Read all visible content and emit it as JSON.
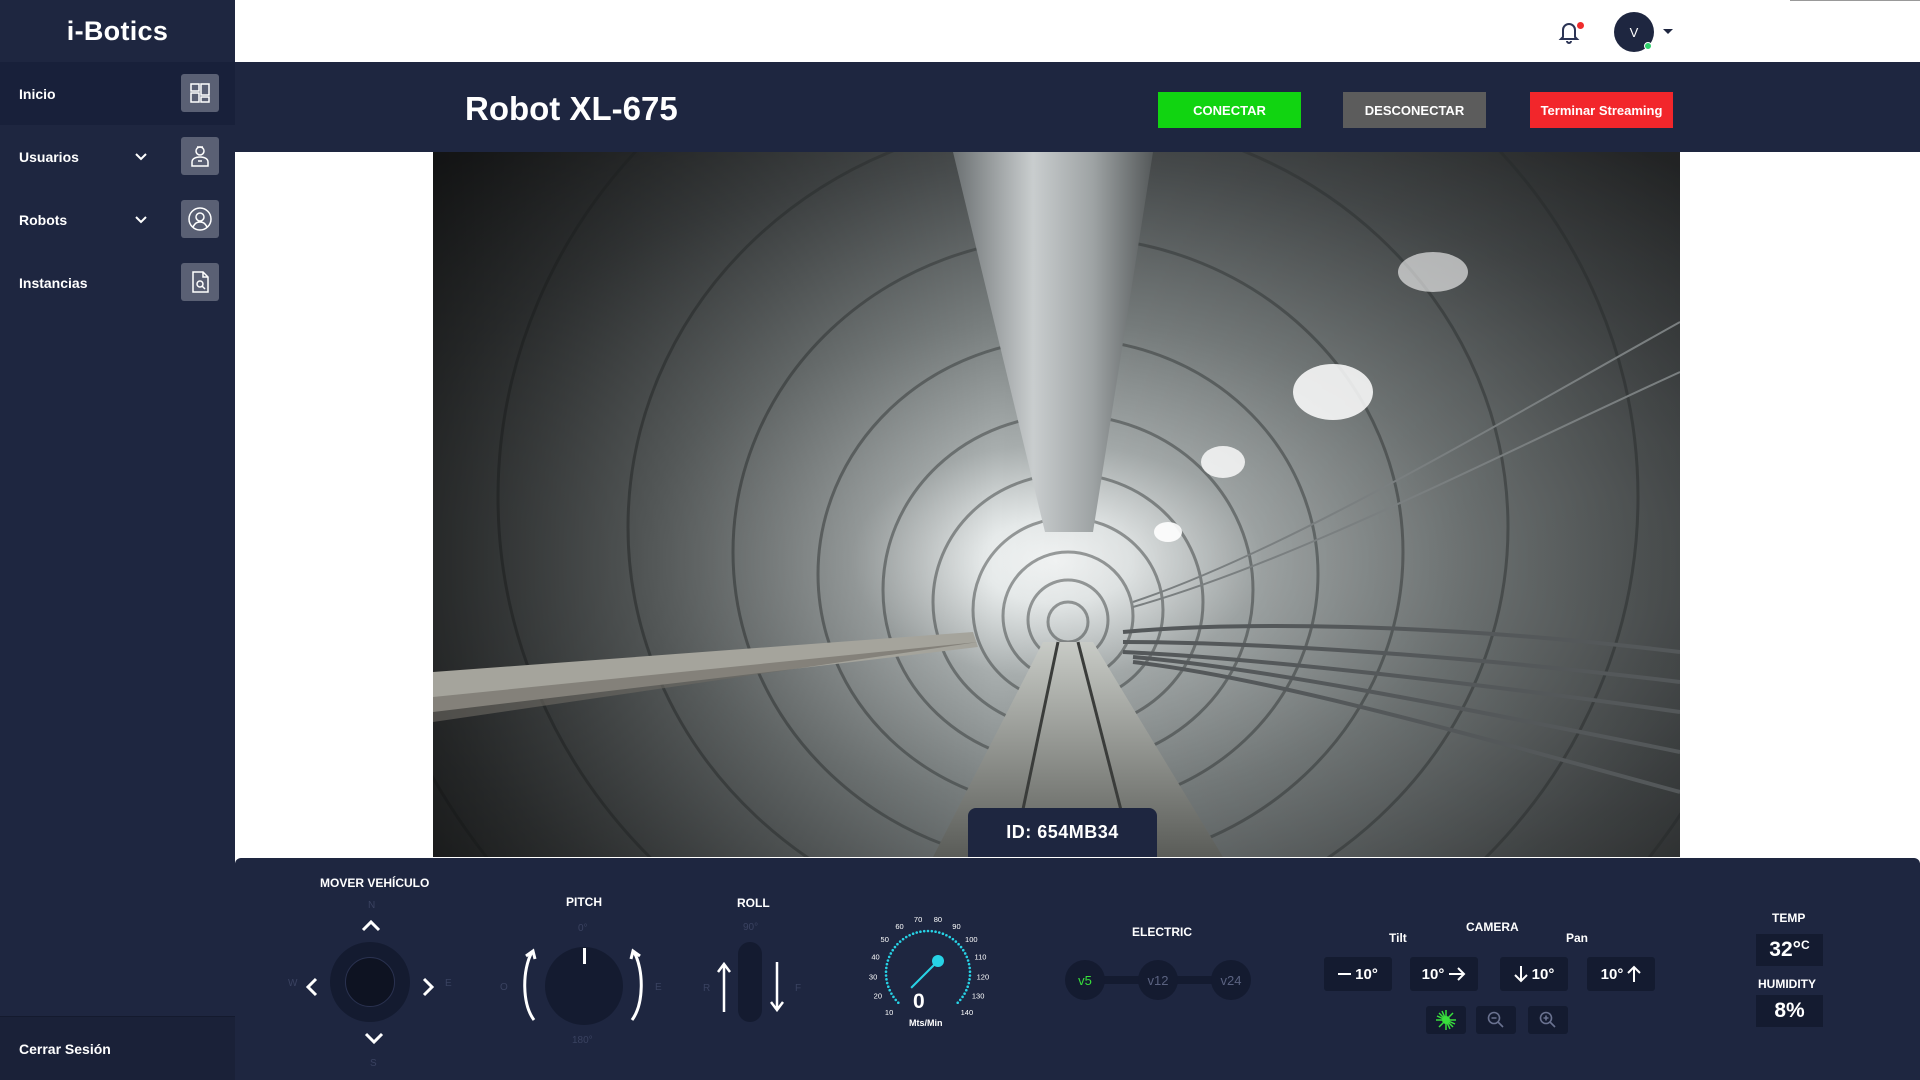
{
  "app": {
    "brand": "i-Botics"
  },
  "sidebar": {
    "items": [
      {
        "label": "Inicio",
        "icon": "dashboard-icon",
        "has_submenu": false
      },
      {
        "label": "Usuarios",
        "icon": "user-icon",
        "has_submenu": true
      },
      {
        "label": "Robots",
        "icon": "robot-icon",
        "has_submenu": true
      },
      {
        "label": "Instancias",
        "icon": "document-search-icon",
        "has_submenu": false
      }
    ],
    "logout_label": "Cerrar Sesión"
  },
  "topbar": {
    "avatar_initial": "V",
    "has_notification": true
  },
  "header": {
    "robot_name": "Robot XL-675",
    "connect_label": "CONECTAR",
    "disconnect_label": "DESCONECTAR",
    "stop_stream_label": "Terminar Streaming"
  },
  "video": {
    "robot_id": "ID: 654MB34"
  },
  "controls": {
    "move_vehicle": {
      "title": "MOVER VEHÍCULO",
      "north": "N",
      "south": "S",
      "east": "E",
      "west": "W"
    },
    "pitch": {
      "title": "PITCH",
      "top": "0°",
      "bottom": "180°",
      "left": "O",
      "right": "E"
    },
    "roll": {
      "title": "ROLL",
      "top": "90°",
      "left": "R",
      "right": "F"
    },
    "speedometer": {
      "value": "0",
      "unit": "Mts/Min",
      "ticks": [
        "10",
        "20",
        "30",
        "40",
        "50",
        "60",
        "70",
        "80",
        "90",
        "100",
        "110",
        "120",
        "130",
        "140"
      ]
    },
    "electric": {
      "title": "ELECTRIC",
      "options": [
        "v5",
        "v12",
        "v24"
      ],
      "active": "v5"
    },
    "camera": {
      "title": "CAMERA",
      "tilt_label": "Tilt",
      "pan_label": "Pan",
      "buttons": [
        "10°",
        "10°",
        "10°",
        "10°"
      ]
    },
    "environment": {
      "temp_label": "TEMP",
      "temp_value": "32°",
      "temp_unit": "C",
      "humidity_label": "HUMIDITY",
      "humidity_value": "8%"
    }
  },
  "colors": {
    "sidebar_bg": "#1e2640",
    "connect": "#11d411",
    "disconnect": "#5c5c5c",
    "stop": "#f2262b",
    "accent_cyan": "#27d3e6",
    "active_green": "#38e03c"
  }
}
